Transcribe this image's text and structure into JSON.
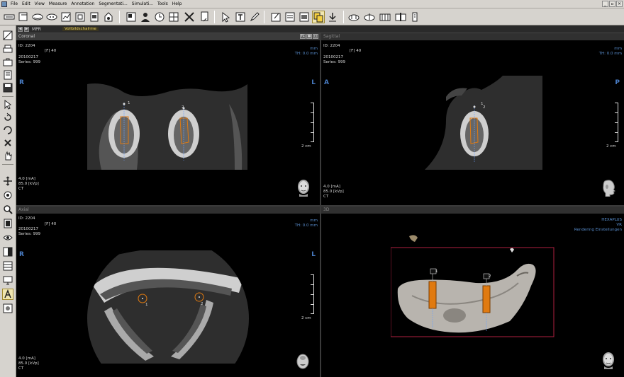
{
  "menu": {
    "items": [
      "File",
      "Edit",
      "View",
      "Measure",
      "Annotation",
      "Segmentati...",
      "Simulati...",
      "Tools",
      "Help"
    ]
  },
  "window_controls": {
    "minimize": "_",
    "restore": "▫",
    "close": "×"
  },
  "toolbar": {
    "icons": [
      "panorama-icon",
      "crossection-icon",
      "skull-icon",
      "skull-3d-icon",
      "chart-icon",
      "measure-box-icon",
      "print-icon",
      "export-icon",
      "screenshot-icon",
      "patient-icon",
      "settings-icon",
      "dental-chart-icon",
      "tools-icon",
      "template-icon",
      "cursor-icon",
      "text-icon",
      "pen-icon",
      "note-icon",
      "sheet-icon",
      "frame-icon",
      "copy-icon",
      "download-icon",
      "implant-group-icon",
      "implant-flip-icon",
      "implant-set-icon",
      "implant-single-icon",
      "book-icon"
    ]
  },
  "left_tools": {
    "icons": [
      "window-level-icon",
      "printer-icon",
      "case-icon",
      "print-icon",
      "save-icon",
      "arrow-icon",
      "rotate-icon",
      "undo-icon",
      "delete-icon",
      "hand-icon",
      "pan-icon",
      "zoom-reset-icon",
      "magnifier-icon",
      "layer-icon",
      "eye-icon",
      "contrast-icon",
      "grid-icon",
      "screen-icon",
      "annotate-a-icon",
      "density-icon"
    ]
  },
  "mpr_bar": {
    "label": "MPR",
    "tab": "Vollbildschalrme"
  },
  "panes": {
    "coronal": {
      "title": "Coronal",
      "flag": "FL",
      "id": "ID: 2204",
      "date": "20100217",
      "series": "Series: 999",
      "f_label": "[F] 40",
      "unit": "mm",
      "thickness": "TH: 0.0 mm",
      "left_orient": "R",
      "right_orient": "L",
      "scale": "2 cm",
      "ma": "4.0 [mA]",
      "kv": "85.0 [kVp]",
      "modality": "CT",
      "implant_labels": [
        "1",
        "2"
      ]
    },
    "sagittal": {
      "title": "Sagittal",
      "id": "ID: 2204",
      "date": "20100217",
      "series": "Series: 999",
      "f_label": "[F] 40",
      "unit": "mm",
      "thickness": "TH: 0.0 mm",
      "left_orient": "A",
      "right_orient": "P",
      "scale": "2 cm",
      "ma": "4.0 [mA]",
      "kv": "85.0 [kVp]",
      "modality": "CT",
      "implant_labels": [
        "1",
        "2"
      ]
    },
    "axial": {
      "title": "Axial",
      "id": "ID: 2204",
      "date": "20100217",
      "series": "Series: 999",
      "f_label": "[F] 40",
      "unit": "mm",
      "thickness": "TH: 0.0 mm",
      "left_orient": "R",
      "right_orient": "L",
      "scale": "2 cm",
      "ma": "4.0 [mA]",
      "kv": "85.0 [kVp]",
      "modality": "CT",
      "implant_labels": [
        "1",
        "2"
      ]
    },
    "threed": {
      "title": "3D",
      "line1": "HEXAPLUS",
      "line2": "VR",
      "line3": "Rendering Einstellungen",
      "implant_labels": [
        "1",
        "2"
      ]
    }
  },
  "colors": {
    "implant": "#e07a10",
    "orient": "#4a7fc8",
    "mpr_tab": "#e8d060"
  }
}
